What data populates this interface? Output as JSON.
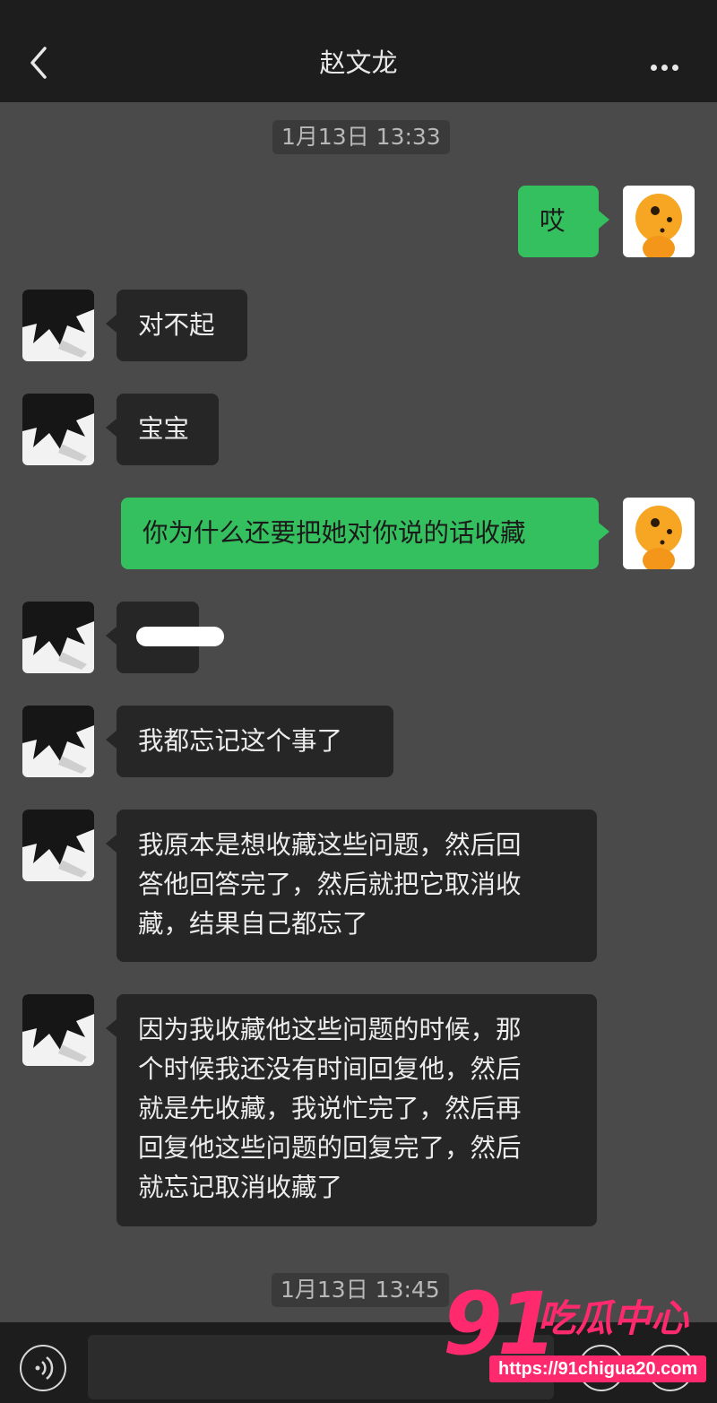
{
  "header": {
    "title": "赵文龙",
    "back_icon": "chevron-left-icon",
    "more_icon": "more-dots-icon"
  },
  "timestamps": [
    "1月13日 13:33",
    "1月13日 13:45"
  ],
  "messages": [
    {
      "side": "out",
      "text": "哎"
    },
    {
      "side": "in",
      "text": "对不起"
    },
    {
      "side": "in",
      "text": "宝宝"
    },
    {
      "side": "out",
      "text": "你为什么还要把她对你说的话收藏"
    },
    {
      "side": "in",
      "text": ""
    },
    {
      "side": "in",
      "text": "我都忘记这个事了"
    },
    {
      "side": "in",
      "lines": [
        "我原本是想收藏这些问题，然后回",
        "答他回答完了，然后就把它取消收",
        "藏，结果自己都忘了"
      ]
    },
    {
      "side": "in",
      "lines": [
        "因为我收藏他这些问题的时候，那",
        "个时候我还没有时间回复他，然后",
        "就是先收藏，我说忙完了，然后再",
        "回复他这些问题的回复完了，然后",
        "就忘记取消收藏了"
      ]
    }
  ],
  "colors": {
    "outgoing_bubble": "#35c05f",
    "incoming_bubble": "#262626",
    "background": "#4a4a4a",
    "watermark": "#ff2a6d"
  },
  "watermark": {
    "number": "91",
    "name": "吃瓜中心",
    "url": "https://91chigua20.com"
  },
  "input_bar": {
    "voice_icon": "voice-icon",
    "emoji_icon": "emoji-icon",
    "plus_icon": "plus-icon"
  }
}
